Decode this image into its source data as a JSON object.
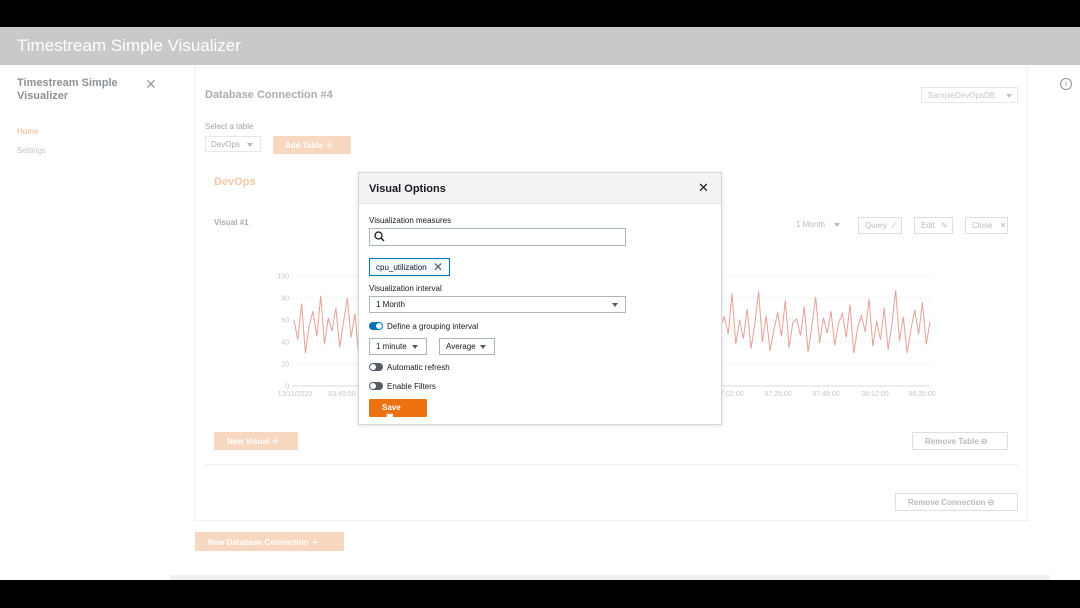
{
  "app": {
    "title": "Timestream Simple Visualizer"
  },
  "nav": {
    "title": "Timestream Simple Visualizer",
    "close_icon": "close-icon",
    "items": [
      {
        "label": "Home",
        "active": true
      },
      {
        "label": "Settings",
        "active": false
      }
    ],
    "info_icon": "i"
  },
  "connection": {
    "title": "Database Connection #4",
    "database": "SampleDevOpsDB",
    "select_table_label": "Select a table",
    "table": "DevOps",
    "add_table_label": "Add Table",
    "table_heading": "DevOps",
    "remove_table_label": "Remove Table",
    "remove_connection_label": "Remove Connection",
    "new_connection_label": "New Database Connection"
  },
  "visual": {
    "title": "Visual #1",
    "interval": "1 Month",
    "query_label": "Query",
    "edit_label": "Edit",
    "close_label": "Close",
    "new_visual_label": "New Visual"
  },
  "modal": {
    "title": "Visual Options",
    "measures_label": "Visualization measures",
    "search_placeholder": "",
    "selected_measure": "cpu_utilization",
    "interval_label": "Visualization interval",
    "interval_value": "1 Month",
    "grouping_label": "Define a grouping interval",
    "grouping_enabled": true,
    "grouping_interval": "1 minute",
    "aggregation": "Average",
    "auto_refresh_label": "Automatic refresh",
    "auto_refresh_enabled": false,
    "filters_label": "Enable Filters",
    "filters_enabled": false,
    "save_label": "Save"
  },
  "colors": {
    "accent": "#ec7211",
    "toggle_on": "#0073bb",
    "toggle_off": "#545b64",
    "series": "#e3a296"
  },
  "chart_data": {
    "type": "line",
    "series": [
      {
        "values": [
          60,
          42,
          75,
          30,
          55,
          68,
          45,
          82,
          38,
          62,
          50,
          71,
          35,
          58,
          80,
          44,
          66,
          28,
          53,
          77,
          40,
          61,
          49,
          73,
          36,
          57,
          85,
          42,
          64,
          31,
          52,
          70,
          46,
          79,
          34,
          59,
          67,
          41,
          75,
          29,
          55,
          63,
          48,
          81,
          37,
          60,
          44,
          72,
          33,
          56,
          88,
          40,
          65,
          30,
          51,
          69,
          45,
          78,
          36,
          58,
          62,
          47,
          74,
          32,
          54,
          83,
          39,
          61,
          50,
          70,
          35,
          57,
          66,
          43,
          76,
          30,
          53,
          64,
          48,
          82,
          38,
          59,
          45,
          71,
          34,
          56,
          90,
          41,
          63,
          31,
          52,
          68,
          46,
          77,
          37,
          58,
          60,
          44,
          73,
          33,
          55,
          80,
          40,
          62,
          49,
          69,
          36,
          57,
          65,
          42,
          75,
          29,
          54,
          63,
          47,
          84,
          38,
          60,
          43,
          70,
          34,
          56,
          86,
          40,
          64,
          32,
          51,
          67,
          45,
          78,
          35,
          58,
          61,
          46,
          72,
          31,
          55,
          81,
          39,
          62,
          48,
          68,
          37,
          57,
          66,
          44,
          74,
          30,
          53,
          64,
          49,
          79,
          36,
          59,
          42,
          71,
          33,
          56,
          87,
          41,
          63,
          30,
          52,
          69,
          47,
          76,
          38,
          58
        ]
      }
    ],
    "x_ticks": [
      "13/11/2020",
      "03:49:00",
      "07:02:00",
      "07:25:00",
      "07:48:00",
      "08:12:00",
      "08:35:00"
    ],
    "y_ticks": [
      "0",
      "20",
      "40",
      "60",
      "80",
      "100"
    ],
    "ylim": [
      0,
      100
    ],
    "grid": true
  }
}
